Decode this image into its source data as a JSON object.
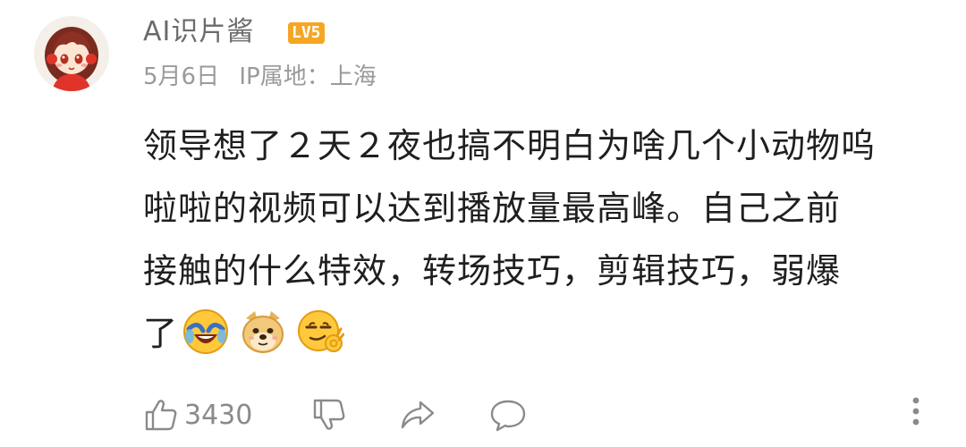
{
  "user": {
    "name": "AI识片酱",
    "level": "LV5"
  },
  "meta": {
    "date": "5月6日",
    "ip_location": "IP属地：上海"
  },
  "comment": {
    "lines": [
      "领导想了２天２夜也搞不明白为啥几个小动物呜",
      "啦啦的视频可以达到播放量最高峰。自己之前",
      "接触的什么特效，转场技巧，剪辑技巧，弱爆",
      "了"
    ],
    "emojis": [
      "laugh-cry-emoji",
      "doge-emoji",
      "smirk-ok-emoji"
    ]
  },
  "actions": {
    "like_count": "3430"
  },
  "colors": {
    "accent": "#f5a623",
    "muted": "#9a9a9a",
    "icon": "#8a8a8a"
  }
}
